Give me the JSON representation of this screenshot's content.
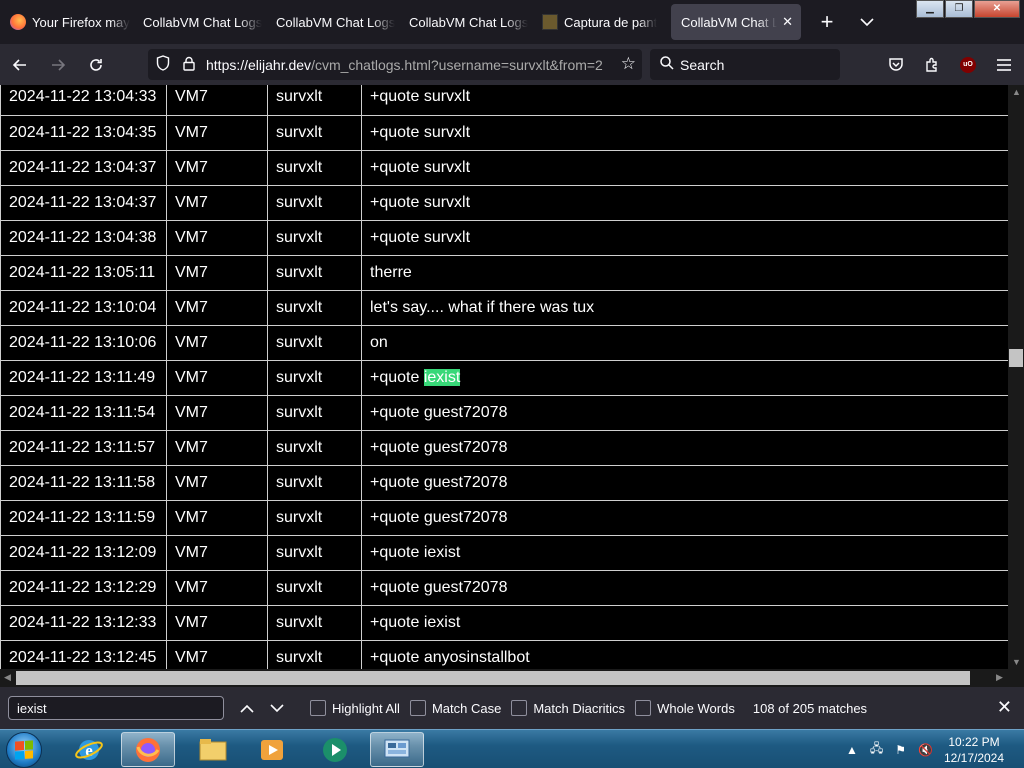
{
  "browser": {
    "tabs": [
      {
        "label": "Your Firefox may",
        "favicon": "firefox-icon",
        "active": false
      },
      {
        "label": "CollabVM Chat Logs",
        "favicon": "none",
        "active": false
      },
      {
        "label": "CollabVM Chat Logs",
        "favicon": "none",
        "active": false
      },
      {
        "label": "CollabVM Chat Logs",
        "favicon": "none",
        "active": false
      },
      {
        "label": "Captura de pant",
        "favicon": "image-icon",
        "active": false
      },
      {
        "label": "CollabVM Chat Lo",
        "favicon": "none",
        "active": true
      }
    ],
    "url_host": "https://elijahr.dev",
    "url_path": "/cvm_chatlogs.html?username=survxlt&from=2",
    "search_placeholder": "Search",
    "ublock_badge": "uO"
  },
  "log_rows": [
    {
      "time": "2024-11-22 13:04:33",
      "vm": "VM7",
      "user": "survxlt",
      "msg": "+quote survxlt"
    },
    {
      "time": "2024-11-22 13:04:35",
      "vm": "VM7",
      "user": "survxlt",
      "msg": "+quote survxlt"
    },
    {
      "time": "2024-11-22 13:04:37",
      "vm": "VM7",
      "user": "survxlt",
      "msg": "+quote survxlt"
    },
    {
      "time": "2024-11-22 13:04:37",
      "vm": "VM7",
      "user": "survxlt",
      "msg": "+quote survxlt"
    },
    {
      "time": "2024-11-22 13:04:38",
      "vm": "VM7",
      "user": "survxlt",
      "msg": "+quote survxlt"
    },
    {
      "time": "2024-11-22 13:05:11",
      "vm": "VM7",
      "user": "survxlt",
      "msg": "therre"
    },
    {
      "time": "2024-11-22 13:10:04",
      "vm": "VM7",
      "user": "survxlt",
      "msg": "let's say.... what if there was tux"
    },
    {
      "time": "2024-11-22 13:10:06",
      "vm": "VM7",
      "user": "survxlt",
      "msg": "on"
    },
    {
      "time": "2024-11-22 13:11:49",
      "vm": "VM7",
      "user": "survxlt",
      "msg_prefix": "+quote ",
      "msg_highlight": "iexist"
    },
    {
      "time": "2024-11-22 13:11:54",
      "vm": "VM7",
      "user": "survxlt",
      "msg": "+quote guest72078"
    },
    {
      "time": "2024-11-22 13:11:57",
      "vm": "VM7",
      "user": "survxlt",
      "msg": "+quote guest72078"
    },
    {
      "time": "2024-11-22 13:11:58",
      "vm": "VM7",
      "user": "survxlt",
      "msg": "+quote guest72078"
    },
    {
      "time": "2024-11-22 13:11:59",
      "vm": "VM7",
      "user": "survxlt",
      "msg": "+quote guest72078"
    },
    {
      "time": "2024-11-22 13:12:09",
      "vm": "VM7",
      "user": "survxlt",
      "msg": "+quote iexist"
    },
    {
      "time": "2024-11-22 13:12:29",
      "vm": "VM7",
      "user": "survxlt",
      "msg": "+quote guest72078"
    },
    {
      "time": "2024-11-22 13:12:33",
      "vm": "VM7",
      "user": "survxlt",
      "msg": "+quote iexist"
    },
    {
      "time": "2024-11-22 13:12:45",
      "vm": "VM7",
      "user": "survxlt",
      "msg": "+quote anyosinstallbot"
    }
  ],
  "findbar": {
    "query": "iexist",
    "highlight_all": "Highlight All",
    "match_case": "Match Case",
    "match_diacritics": "Match Diacritics",
    "whole_words": "Whole Words",
    "match_count": "108 of 205 matches"
  },
  "taskbar": {
    "clock_time": "10:22 PM",
    "clock_date": "12/17/2024"
  },
  "colors": {
    "highlight": "#38d878",
    "toolbar": "#2b2a33",
    "tabstrip": "#1c1b22"
  }
}
